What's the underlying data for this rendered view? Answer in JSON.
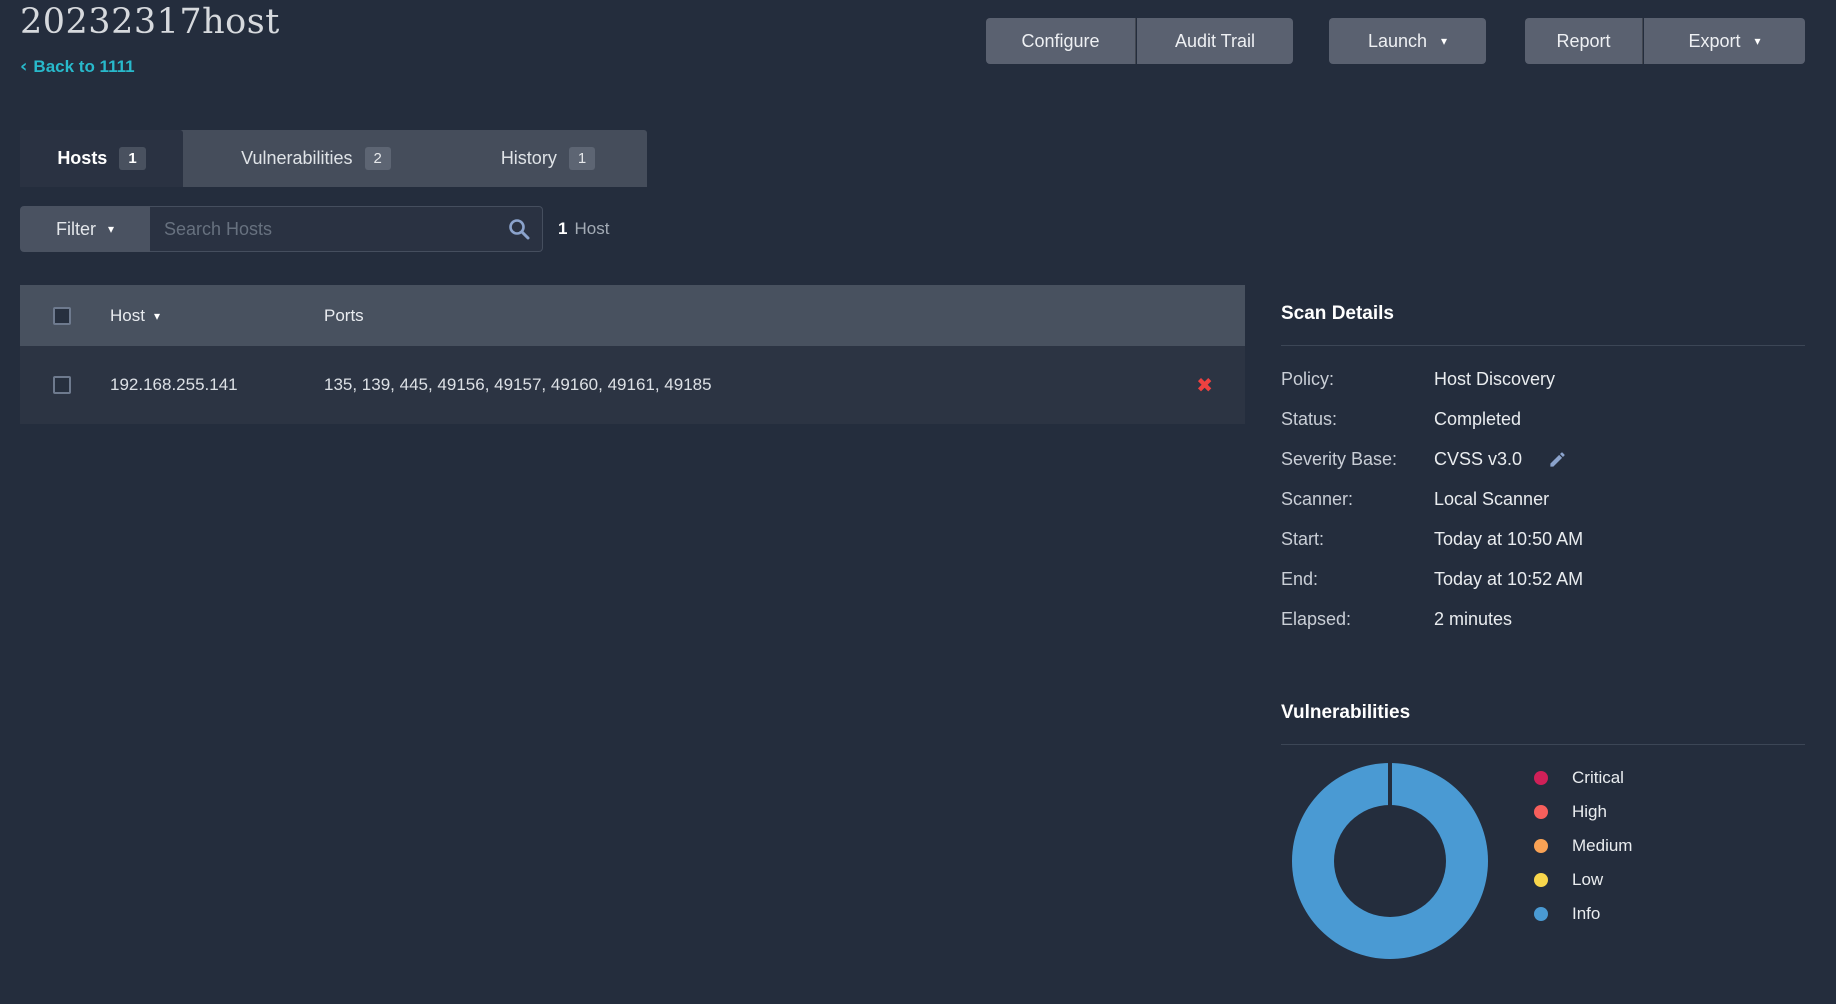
{
  "header": {
    "title": "20232317host",
    "back": {
      "chevron": "‹",
      "label": "Back to 1111"
    },
    "actions": {
      "configure": "Configure",
      "audit_trail": "Audit Trail",
      "launch": "Launch",
      "report": "Report",
      "export": "Export",
      "dropdown_caret": "▾"
    }
  },
  "tabs": [
    {
      "label": "Hosts",
      "count": "1",
      "active": true
    },
    {
      "label": "Vulnerabilities",
      "count": "2",
      "active": false
    },
    {
      "label": "History",
      "count": "1",
      "active": false
    }
  ],
  "filter_bar": {
    "filter_label": "Filter",
    "caret": "▾",
    "search_placeholder": "Search Hosts",
    "result_count": "1",
    "result_label": "Host"
  },
  "hosts_table": {
    "columns": {
      "host": "Host",
      "ports": "Ports"
    },
    "sort_caret": "▾",
    "rows": [
      {
        "host": "192.168.255.141",
        "ports": "135, 139, 445, 49156, 49157, 49160, 49161, 49185",
        "delete_glyph": "✖"
      }
    ]
  },
  "scan_details": {
    "heading": "Scan Details",
    "rows": [
      {
        "label": "Policy:",
        "value": "Host Discovery"
      },
      {
        "label": "Status:",
        "value": "Completed"
      },
      {
        "label": "Severity Base:",
        "value": "CVSS v3.0"
      },
      {
        "label": "Scanner:",
        "value": "Local Scanner"
      },
      {
        "label": "Start:",
        "value": "Today at 10:50 AM"
      },
      {
        "label": "End:",
        "value": "Today at 10:52 AM"
      },
      {
        "label": "Elapsed:",
        "value": "2 minutes"
      }
    ]
  },
  "vulnerabilities_panel": {
    "heading": "Vulnerabilities"
  },
  "chart_data": {
    "type": "pie",
    "donut": true,
    "title": "Vulnerabilities",
    "categories": [
      "Critical",
      "High",
      "Medium",
      "Low",
      "Info"
    ],
    "values": [
      0,
      0,
      0,
      0,
      100
    ],
    "colors": [
      "#d02058",
      "#f75f5c",
      "#f9a255",
      "#f8d64c",
      "#4a9ad3"
    ],
    "legend_position": "right"
  },
  "colors": {
    "background": "#242d3d",
    "accent_cyan": "#28b9cb",
    "button_gray": "#5a6170",
    "table_header": "#48515f",
    "row_background": "#2c3443",
    "donut_info_blue": "#4c97d0",
    "delete_red": "#ee4140"
  }
}
